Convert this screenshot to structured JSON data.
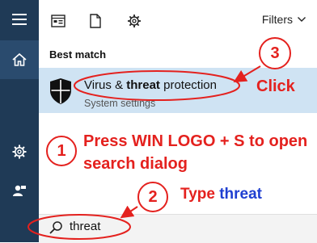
{
  "rail": {
    "items": [
      {
        "icon": "hamburger-menu-icon"
      },
      {
        "icon": "home-icon"
      },
      {
        "icon": "settings-gear-icon"
      },
      {
        "icon": "user-feedback-icon"
      }
    ]
  },
  "toolbar": {
    "filters_label": "Filters"
  },
  "results": {
    "section_label": "Best match",
    "top": {
      "title_prefix": "Virus & ",
      "title_bold": "threat",
      "title_suffix": " protection",
      "subtitle": "System settings"
    }
  },
  "search": {
    "value": "threat"
  },
  "annotations": {
    "step3_number": "3",
    "step3_text": "Click",
    "step1_number": "1",
    "step1_line1": "Press WIN LOGO + S to open",
    "step1_line2": "search dialog",
    "step2_number": "2",
    "step2_prefix": "Type ",
    "step2_word": "threat"
  },
  "colors": {
    "rail": "#1f3a56",
    "highlight": "#cfe3f3",
    "annotation_red": "#e4211e",
    "annotation_blue": "#1f3fd1"
  }
}
